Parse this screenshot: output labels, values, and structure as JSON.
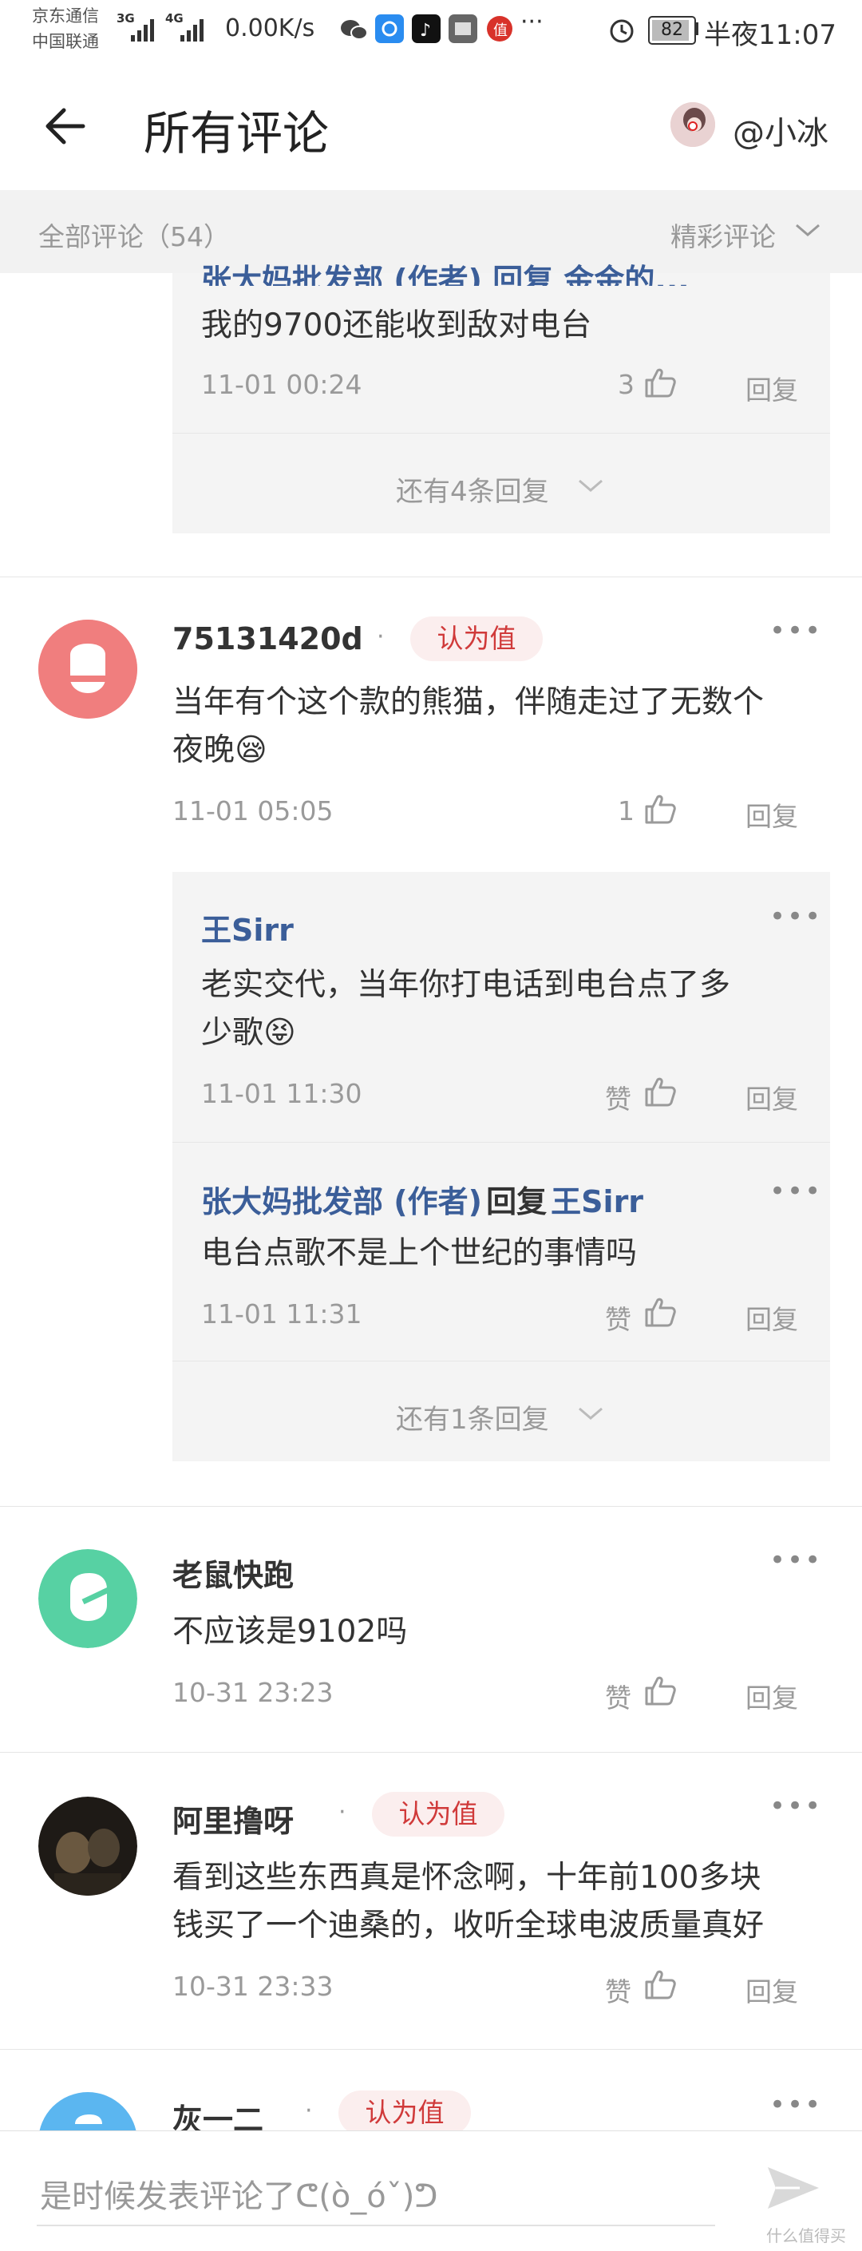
{
  "status_bar": {
    "carrier1": "京东通信",
    "carrier2": "中国联通",
    "net1": "3G",
    "net2": "4G",
    "speed": "0.00K/s",
    "battery": "82",
    "time": "半夜11:07"
  },
  "header": {
    "title": "所有评论",
    "user": "@小冰"
  },
  "tabs": {
    "all": "全部评论（54）",
    "featured": "精彩评论"
  },
  "partial_reply": {
    "header_fragment": "张大妈批发部 (作者) 回复 金金的...",
    "text": "我的9700还能收到敌对电台",
    "time": "11-01 00:24",
    "likes": "3",
    "reply": "回复",
    "more_replies": "还有4条回复"
  },
  "comments": [
    {
      "user": "75131420d",
      "badge": "认为值",
      "text_line1": "当年有个这个款的熊猫，伴随走过了无数个",
      "text_line2": "夜晚😪",
      "time": "11-01 05:05",
      "likes": "1",
      "reply": "回复",
      "avatar_color": "#f07e7e",
      "replies": [
        {
          "user": "王Sirr",
          "text_line1": "老实交代，当年你打电话到电台点了多",
          "text_line2": "少歌😝",
          "time": "11-01 11:30",
          "likes": "赞",
          "reply": "回复"
        },
        {
          "user": "张大妈批发部 (作者)",
          "mid": "回复",
          "to": "王Sirr",
          "text_line1": "电台点歌不是上个世纪的事情吗",
          "time": "11-01 11:31",
          "likes": "赞",
          "reply": "回复"
        }
      ],
      "more_replies": "还有1条回复"
    },
    {
      "user": "老鼠快跑",
      "text_line1": "不应该是9102吗",
      "time": "10-31 23:23",
      "likes": "赞",
      "reply": "回复",
      "avatar_color": "#57d1a3"
    },
    {
      "user": "阿里撸呀",
      "badge": "认为值",
      "text_line1": "看到这些东西真是怀念啊，十年前100多块",
      "text_line2": "钱买了一个迪桑的，收听全球电波质量真好",
      "time": "10-31 23:33",
      "likes": "赞",
      "reply": "回复"
    },
    {
      "user": "灰一二",
      "badge": "认为值",
      "avatar_color": "#5bb6f0"
    }
  ],
  "bottom": {
    "placeholder": "是时候发表评论了ᕦ(ò_óˇ)ᕤ",
    "watermark": "什么值得买"
  },
  "colors": {
    "link": "#3b5e99",
    "badge_text": "#d03a3a",
    "badge_bg": "#fbeeee"
  }
}
